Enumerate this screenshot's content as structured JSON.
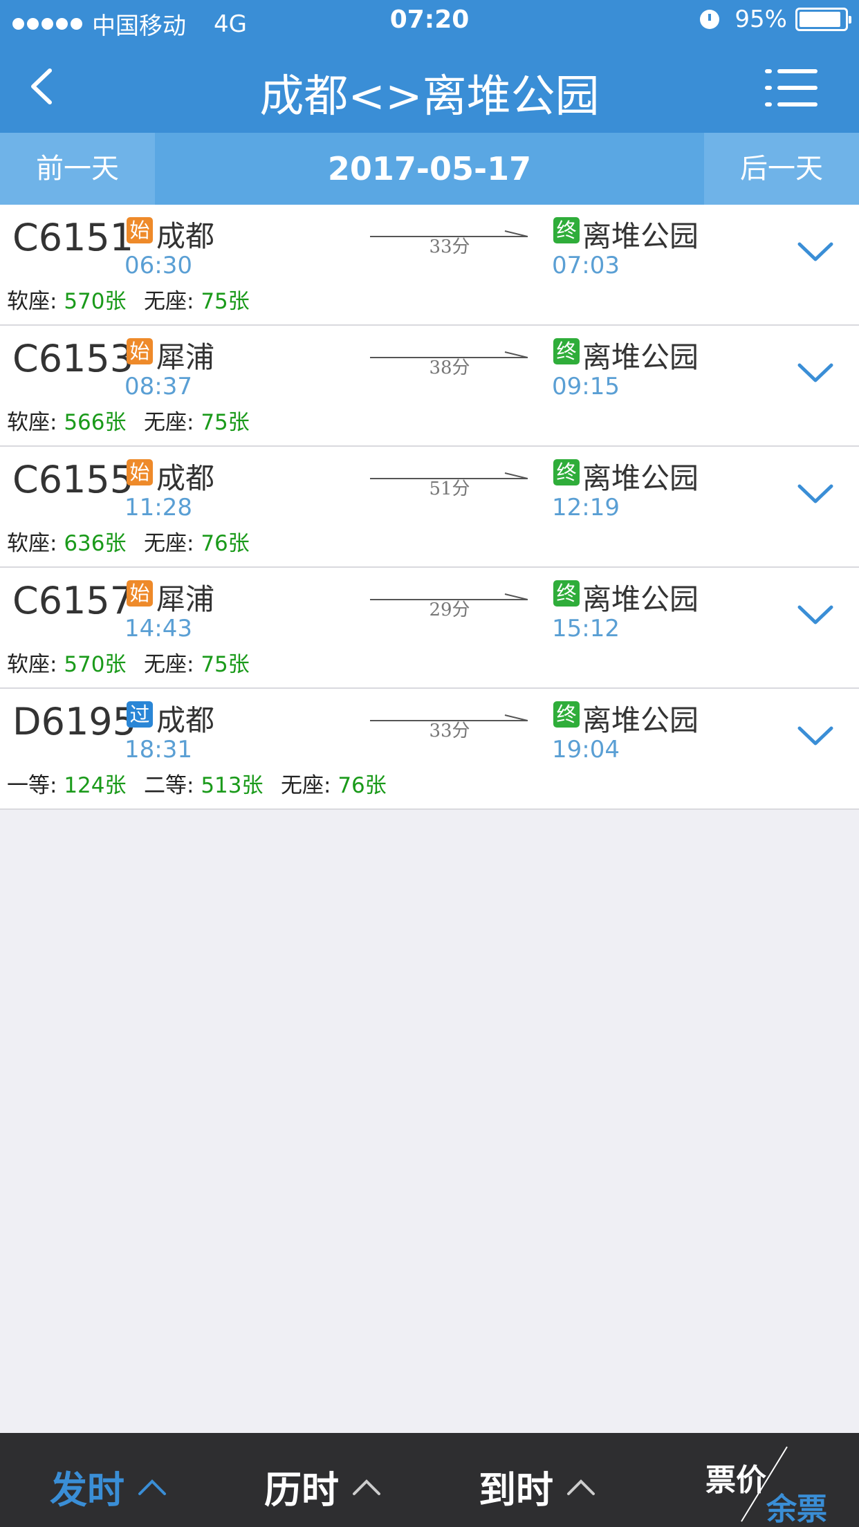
{
  "status_bar": {
    "carrier": "中国移动",
    "network": "4G",
    "time": "07:20",
    "battery": "95%",
    "battery_level": 0.95
  },
  "nav": {
    "title": "成都<>离堆公园",
    "back_icon": "chevron-left-icon",
    "menu_icon": "menu-list-icon"
  },
  "date_bar": {
    "prev_label": "前一天",
    "date": "2017-05-17",
    "next_label": "后一天"
  },
  "trains": [
    {
      "number": "C6151",
      "from_tag": "始",
      "from_tag_color": "#ee8a2a",
      "from": "成都",
      "dep": "06:30",
      "duration": "33分",
      "to_tag": "终",
      "to": "离堆公园",
      "arr": "07:03",
      "seats": [
        {
          "type": "软座",
          "count": "570张"
        },
        {
          "type": "无座",
          "count": "75张"
        }
      ]
    },
    {
      "number": "C6153",
      "from_tag": "始",
      "from_tag_color": "#ee8a2a",
      "from": "犀浦",
      "dep": "08:37",
      "duration": "38分",
      "to_tag": "终",
      "to": "离堆公园",
      "arr": "09:15",
      "seats": [
        {
          "type": "软座",
          "count": "566张"
        },
        {
          "type": "无座",
          "count": "75张"
        }
      ]
    },
    {
      "number": "C6155",
      "from_tag": "始",
      "from_tag_color": "#ee8a2a",
      "from": "成都",
      "dep": "11:28",
      "duration": "51分",
      "to_tag": "终",
      "to": "离堆公园",
      "arr": "12:19",
      "seats": [
        {
          "type": "软座",
          "count": "636张"
        },
        {
          "type": "无座",
          "count": "76张"
        }
      ]
    },
    {
      "number": "C6157",
      "from_tag": "始",
      "from_tag_color": "#ee8a2a",
      "from": "犀浦",
      "dep": "14:43",
      "duration": "29分",
      "to_tag": "终",
      "to": "离堆公园",
      "arr": "15:12",
      "seats": [
        {
          "type": "软座",
          "count": "570张"
        },
        {
          "type": "无座",
          "count": "75张"
        }
      ]
    },
    {
      "number": "D6195",
      "from_tag": "过",
      "from_tag_color": "#2a86d6",
      "from": "成都",
      "dep": "18:31",
      "duration": "33分",
      "to_tag": "终",
      "to": "离堆公园",
      "arr": "19:04",
      "seats": [
        {
          "type": "一等",
          "count": "124张"
        },
        {
          "type": "二等",
          "count": "513张"
        },
        {
          "type": "无座",
          "count": "76张"
        }
      ]
    }
  ],
  "sort_bar": {
    "depart": "发时",
    "duration": "历时",
    "arrive": "到时",
    "price": "票价",
    "remaining": "余票",
    "active_color": "#3a8ed6"
  }
}
